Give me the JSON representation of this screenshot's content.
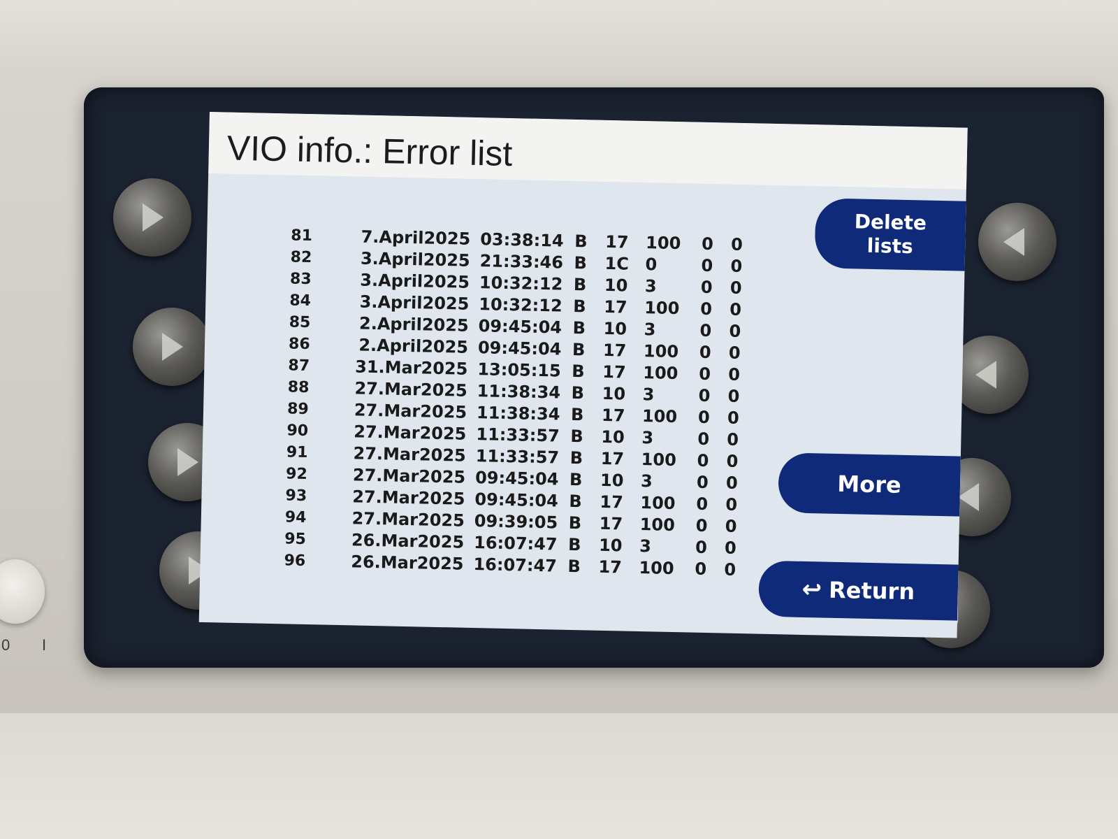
{
  "screen": {
    "title": "VIO info.: Error list"
  },
  "buttons": {
    "delete_line1": "Delete",
    "delete_line2": "lists",
    "more": "More",
    "return": "Return"
  },
  "error_list": [
    {
      "no": "81",
      "date": "7.April2025",
      "time": "03:38:14",
      "b": "B",
      "a": "17",
      "v": "100",
      "c": "0",
      "d": "0"
    },
    {
      "no": "82",
      "date": "3.April2025",
      "time": "21:33:46",
      "b": "B",
      "a": "1C",
      "v": "0",
      "c": "0",
      "d": "0"
    },
    {
      "no": "83",
      "date": "3.April2025",
      "time": "10:32:12",
      "b": "B",
      "a": "10",
      "v": "3",
      "c": "0",
      "d": "0"
    },
    {
      "no": "84",
      "date": "3.April2025",
      "time": "10:32:12",
      "b": "B",
      "a": "17",
      "v": "100",
      "c": "0",
      "d": "0"
    },
    {
      "no": "85",
      "date": "2.April2025",
      "time": "09:45:04",
      "b": "B",
      "a": "10",
      "v": "3",
      "c": "0",
      "d": "0"
    },
    {
      "no": "86",
      "date": "2.April2025",
      "time": "09:45:04",
      "b": "B",
      "a": "17",
      "v": "100",
      "c": "0",
      "d": "0"
    },
    {
      "no": "87",
      "date": "31.Mar2025",
      "time": "13:05:15",
      "b": "B",
      "a": "17",
      "v": "100",
      "c": "0",
      "d": "0"
    },
    {
      "no": "88",
      "date": "27.Mar2025",
      "time": "11:38:34",
      "b": "B",
      "a": "10",
      "v": "3",
      "c": "0",
      "d": "0"
    },
    {
      "no": "89",
      "date": "27.Mar2025",
      "time": "11:38:34",
      "b": "B",
      "a": "17",
      "v": "100",
      "c": "0",
      "d": "0"
    },
    {
      "no": "90",
      "date": "27.Mar2025",
      "time": "11:33:57",
      "b": "B",
      "a": "10",
      "v": "3",
      "c": "0",
      "d": "0"
    },
    {
      "no": "91",
      "date": "27.Mar2025",
      "time": "11:33:57",
      "b": "B",
      "a": "17",
      "v": "100",
      "c": "0",
      "d": "0"
    },
    {
      "no": "92",
      "date": "27.Mar2025",
      "time": "09:45:04",
      "b": "B",
      "a": "10",
      "v": "3",
      "c": "0",
      "d": "0"
    },
    {
      "no": "93",
      "date": "27.Mar2025",
      "time": "09:45:04",
      "b": "B",
      "a": "17",
      "v": "100",
      "c": "0",
      "d": "0"
    },
    {
      "no": "94",
      "date": "27.Mar2025",
      "time": "09:39:05",
      "b": "B",
      "a": "17",
      "v": "100",
      "c": "0",
      "d": "0"
    },
    {
      "no": "95",
      "date": "26.Mar2025",
      "time": "16:07:47",
      "b": "B",
      "a": "10",
      "v": "3",
      "c": "0",
      "d": "0"
    },
    {
      "no": "96",
      "date": "26.Mar2025",
      "time": "16:07:47",
      "b": "B",
      "a": "17",
      "v": "100",
      "c": "0",
      "d": "0"
    }
  ],
  "device": {
    "power_off_symbol": "0",
    "power_on_symbol": "I"
  },
  "icons": {
    "return": "return-arrow-icon",
    "knobs": "triangle-arrow-icon"
  },
  "colors": {
    "button_bg": "#0f2a78",
    "screen_bg": "#dfe6ee",
    "title_bar_bg": "#f3f4f2",
    "bezel": "#1b2230"
  }
}
